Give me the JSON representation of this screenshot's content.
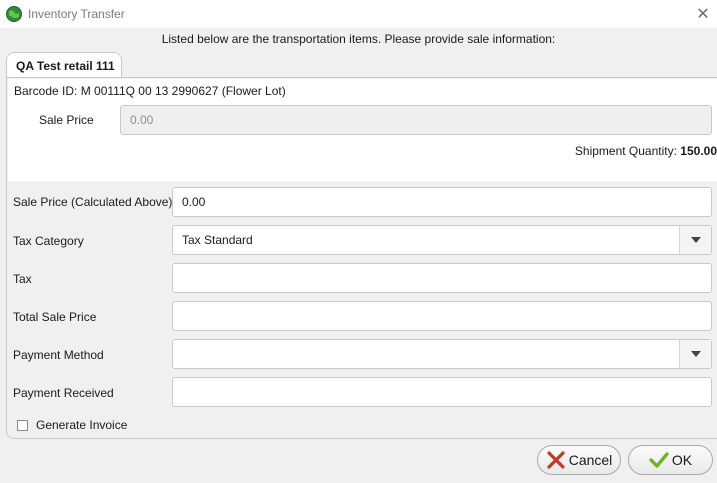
{
  "window": {
    "title": "Inventory Transfer",
    "close_icon": "close-icon",
    "app_icon": "globe-icon"
  },
  "instruction": "Listed below are the transportation items. Please provide sale information:",
  "tabs": [
    {
      "label": "QA Test retail 111",
      "active": true
    }
  ],
  "item": {
    "barcode_text": "Barcode ID: M 00111Q 00 13 2990627 (Flower Lot)",
    "sale_price_label": "Sale Price",
    "sale_price_placeholder": "0.00",
    "shipment_quantity_label": "Shipment Quantity:",
    "shipment_quantity_value": "150.00"
  },
  "form": {
    "sale_price_calc_label": "Sale Price (Calculated Above)",
    "sale_price_calc_value": "0.00",
    "tax_category_label": "Tax Category",
    "tax_category_value": "Tax Standard",
    "tax_label": "Tax",
    "tax_value": "",
    "total_sale_price_label": "Total Sale Price",
    "total_sale_price_value": "",
    "payment_method_label": "Payment Method",
    "payment_method_value": "",
    "payment_received_label": "Payment Received",
    "payment_received_value": "",
    "generate_invoice_label": "Generate Invoice",
    "generate_invoice_checked": false
  },
  "buttons": {
    "cancel_label": "Cancel",
    "ok_label": "OK"
  },
  "colors": {
    "cancel_icon": "#c0392b",
    "ok_icon": "#6fb52c",
    "background": "#f0f0f0"
  }
}
